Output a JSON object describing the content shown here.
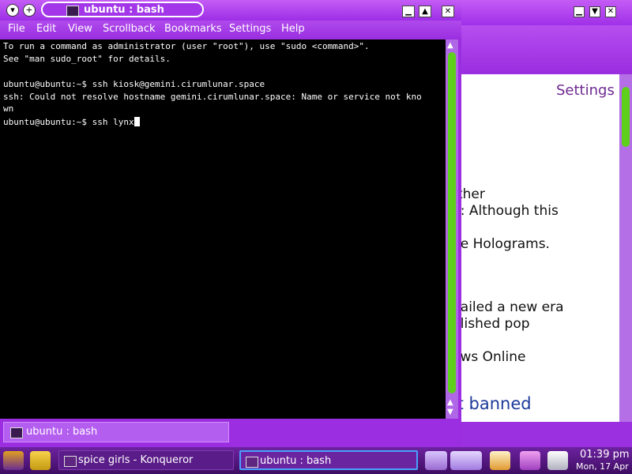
{
  "background_window": {
    "page_heading": "Settings",
    "visible_lines": [
      "rther",
      "E: Although this",
      "he Holograms.",
      "nailed a new era",
      "blished pop",
      "ews Online"
    ],
    "link_fragment": "rt banned"
  },
  "terminal": {
    "title": "ubuntu : bash",
    "menu": [
      "File",
      "Edit",
      "View",
      "Scrollback",
      "Bookmarks",
      "Settings",
      "Help"
    ],
    "lines": [
      "To run a command as administrator (user \"root\"), use \"sudo <command>\".",
      "See \"man sudo_root\" for details.",
      "",
      "ubuntu@ubuntu:~$ ssh kiosk@gemini.cirumlunar.space",
      "ssh: Could not resolve hostname gemini.cirumlunar.space: Name or service not kno",
      "wn"
    ],
    "prompt_line": "ubuntu@ubuntu:~$ ssh lynx",
    "tab_label": "ubuntu : bash"
  },
  "taskbar": {
    "tasks": [
      {
        "label": "spice girls - Konqueror",
        "active": false
      },
      {
        "label": "ubuntu : bash",
        "active": true
      }
    ],
    "clock_time": "01:39 pm",
    "clock_date": "Mon, 17 Apr"
  },
  "colors": {
    "accent": "#9b2ee0",
    "scroll_thumb": "#5ed01c",
    "terminal_bg": "#000000"
  }
}
